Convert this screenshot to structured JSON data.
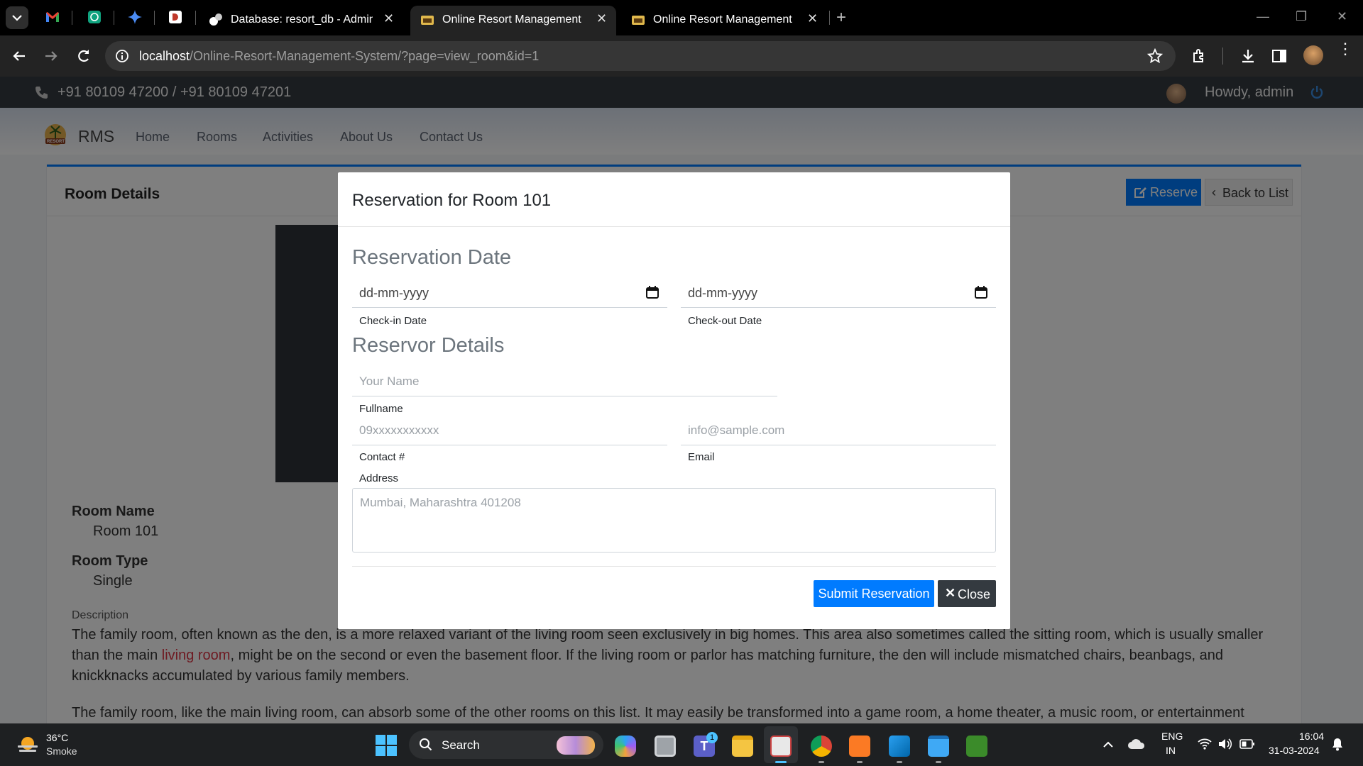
{
  "browser": {
    "tabs": [
      {
        "title": "Database: resort_db - Adminer"
      },
      {
        "title": "Online Resort Management Sys"
      },
      {
        "title": "Online Resort Management Sys"
      }
    ],
    "url_host": "localhost",
    "url_path": "/Online-Resort-Management-System/?page=view_room&id=1"
  },
  "site": {
    "phone": "+91 80109 47200 / +91 80109 47201",
    "greeting": "Howdy, admin",
    "brand": "RMS",
    "logo_text": "RESORT",
    "nav": [
      "Home",
      "Rooms",
      "Activities",
      "About Us",
      "Contact Us"
    ]
  },
  "room": {
    "header": "Room Details",
    "reserve_label": "Reserve",
    "back_label": "Back to List",
    "name_label": "Room Name",
    "name_value": "Room 101",
    "type_label": "Room Type",
    "type_value": "Single",
    "description_label": "Description",
    "desc_p1_start": "The family room, often known as the den, is a more relaxed variant of the living room seen exclusively in big homes. This area also sometimes called the sitting room, which is usually smaller than the main ",
    "desc_p1_link": "living room",
    "desc_p1_end": ", might be on the second or even the basement floor. If the living room or parlor has matching furniture, the den will include mismatched chairs, beanbags, and knickknacks accumulated by various family members.",
    "desc_p2": "The family room, like the main living room, can absorb some of the other rooms on this list. It may easily be transformed into a game room, a home theater, a music room, or entertainment"
  },
  "modal": {
    "title": "Reservation for Room 101",
    "date_section": "Reservation Date",
    "checkin_value": "dd-mm-yyyy",
    "checkin_caption": "Check-in Date",
    "checkout_value": "dd-mm-yyyy",
    "checkout_caption": "Check-out Date",
    "reservor_section": "Reservor Details",
    "name_placeholder": "Your Name",
    "name_caption": "Fullname",
    "contact_placeholder": "09xxxxxxxxxxx",
    "contact_caption": "Contact #",
    "email_placeholder": "info@sample.com",
    "email_caption": "Email",
    "address_caption": "Address",
    "address_placeholder": "Mumbai, Maharashtra 401208",
    "submit_label": "Submit Reservation",
    "close_label": "Close"
  },
  "taskbar": {
    "temperature": "36°C",
    "weather": "Smoke",
    "search_label": "Search",
    "teams_badge": "1",
    "lang_top": "ENG",
    "lang_bottom": "IN",
    "time": "16:04",
    "date": "31-03-2024"
  },
  "colors": {
    "primary": "#007bff",
    "link": "#dc3545",
    "dark": "#343a40",
    "overlay": "rgba(0,0,0,0.5)"
  }
}
